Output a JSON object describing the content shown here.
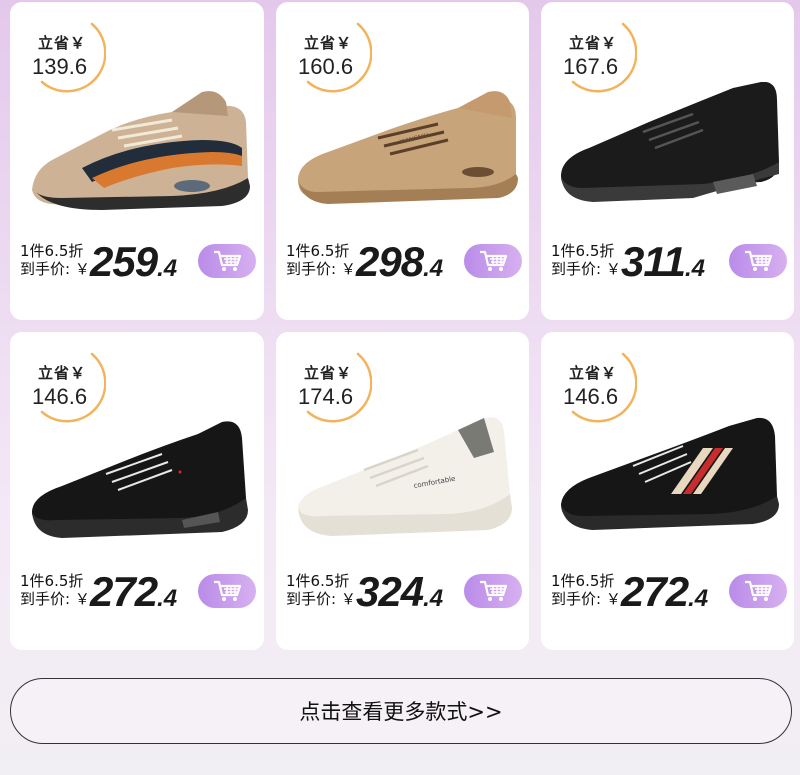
{
  "save_label": "立省￥",
  "deal_line": "1件6.5折",
  "final_label": "到手价: ￥",
  "more_button": "点击查看更多款式>>",
  "products": [
    {
      "save": "139.6",
      "price_int": "259",
      "price_dec": ".4",
      "shoe": "khaki-sport-sneaker"
    },
    {
      "save": "160.6",
      "price_int": "298",
      "price_dec": ".4",
      "shoe": "tan-suede-casual-shoe"
    },
    {
      "save": "167.6",
      "price_int": "311",
      "price_dec": ".4",
      "shoe": "black-leather-sneaker"
    },
    {
      "save": "146.6",
      "price_int": "272",
      "price_dec": ".4",
      "shoe": "black-leather-runner"
    },
    {
      "save": "174.6",
      "price_int": "324",
      "price_dec": ".4",
      "shoe": "white-comfortable-sneaker"
    },
    {
      "save": "146.6",
      "price_int": "272",
      "price_dec": ".4",
      "shoe": "black-striped-sneaker"
    }
  ],
  "shoe_texts": {
    "comfortable": "comfortable"
  },
  "colors": {
    "accent_purple": "#c59ef0",
    "badge_ring": "#f0a23a"
  }
}
